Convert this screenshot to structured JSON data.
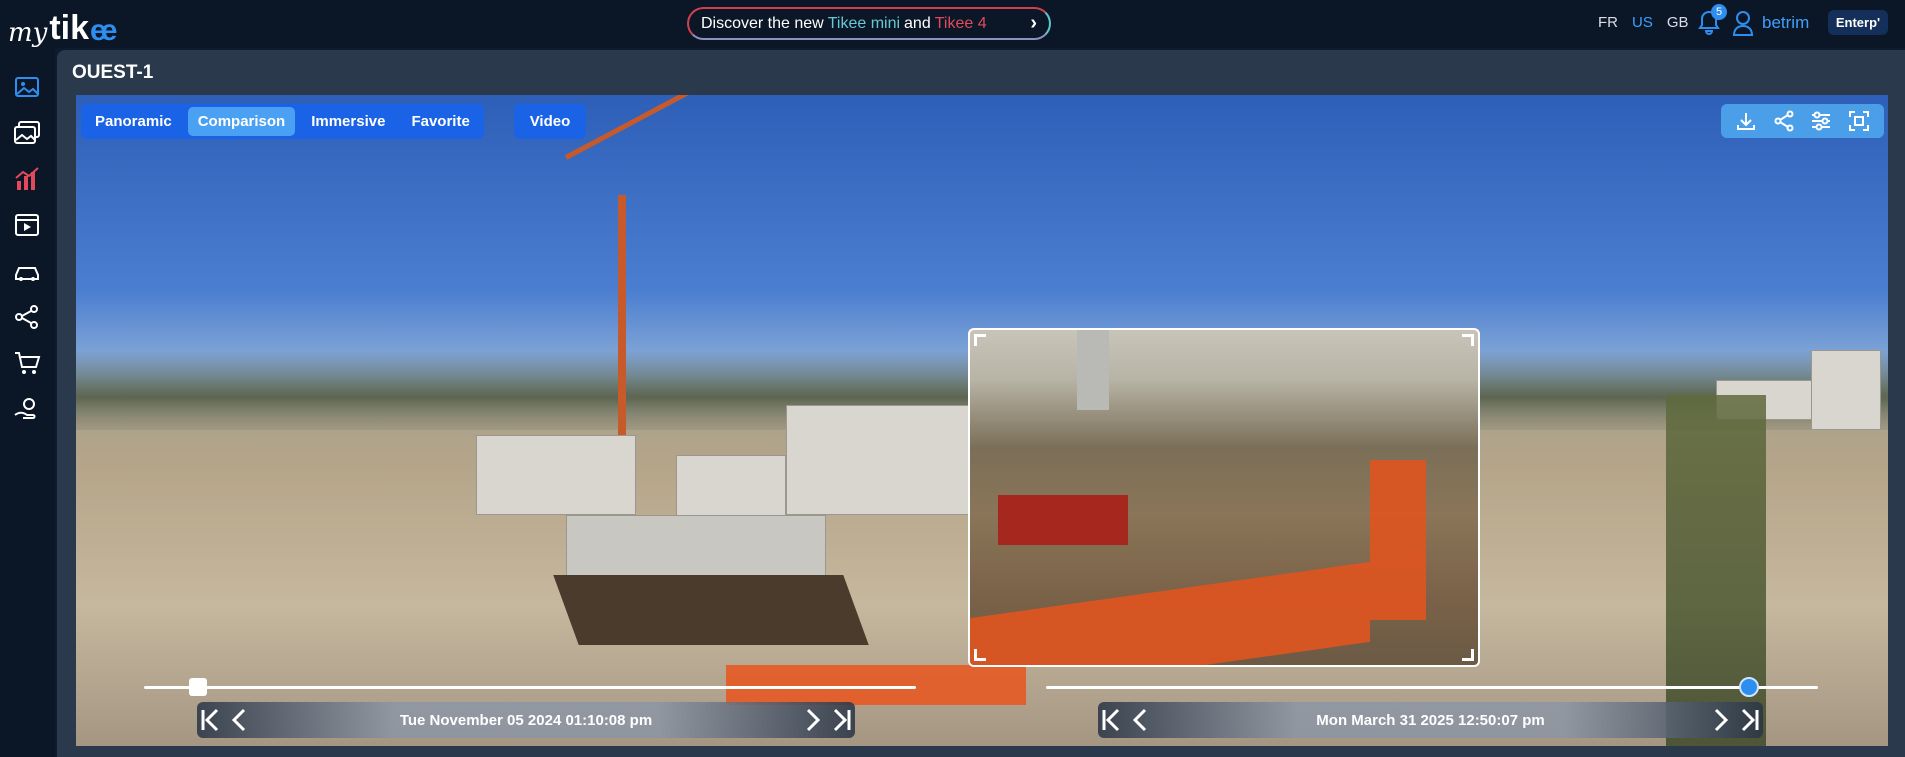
{
  "brand": {
    "logo_my": "my",
    "logo_tik": "tik",
    "logo_ee": "ee"
  },
  "promo": {
    "prefix": "Discover the new",
    "product1": "Tikee mini",
    "joiner": "and",
    "product2": "Tikee 4"
  },
  "languages": [
    {
      "code": "FR",
      "active": false
    },
    {
      "code": "US",
      "active": true
    },
    {
      "code": "GB",
      "active": false
    }
  ],
  "notifications": {
    "count": "5"
  },
  "user": {
    "name": "betrim",
    "plan": "Enterp'"
  },
  "sidebar": {
    "items": [
      {
        "name": "image-icon"
      },
      {
        "name": "gallery-icon"
      },
      {
        "name": "chart-icon"
      },
      {
        "name": "video-icon"
      },
      {
        "name": "cars-icon"
      },
      {
        "name": "share-icon"
      },
      {
        "name": "cart-icon"
      },
      {
        "name": "support-icon"
      }
    ]
  },
  "page": {
    "title": "OUEST-1"
  },
  "tabs": [
    {
      "label": "Panoramic",
      "active": false
    },
    {
      "label": "Comparison",
      "active": true
    },
    {
      "label": "Immersive",
      "active": false
    },
    {
      "label": "Favorite",
      "active": false
    }
  ],
  "video_label": "Video",
  "tools": [
    "download-icon",
    "share-icon",
    "settings-sliders-icon",
    "fullscreen-icon"
  ],
  "timeline_left": {
    "date": "Tue November 05 2024 01:10:08 pm",
    "position": 0.07
  },
  "timeline_right": {
    "date": "Mon March 31 2025 12:50:07 pm",
    "position": 0.91
  },
  "colors": {
    "accent": "#2e8ef0",
    "tab_bg": "#1a63e6",
    "tab_active": "#4aa1f4",
    "promo_red": "#e24a5b",
    "promo_teal": "#67c7d2"
  }
}
